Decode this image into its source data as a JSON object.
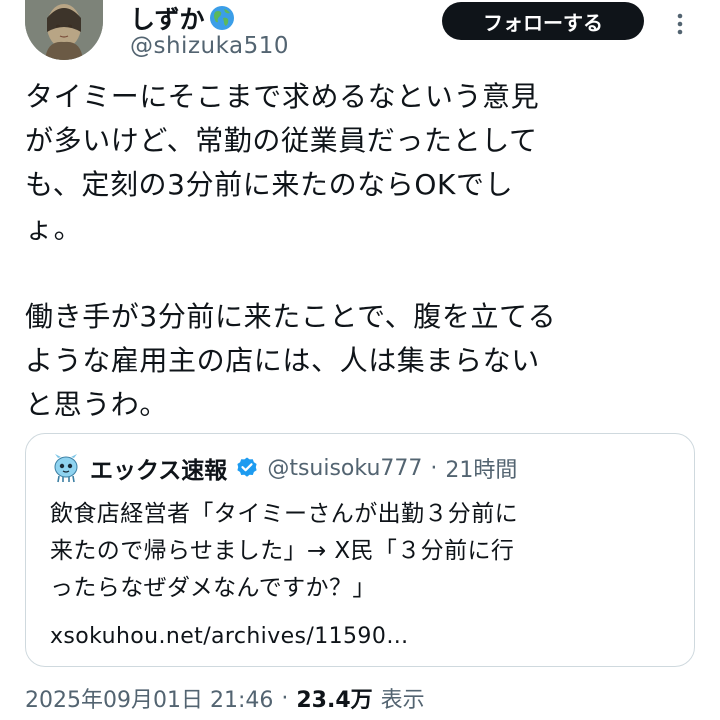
{
  "author": {
    "display_name": "しずか",
    "handle": "@shizuka510",
    "globe_icon": "globe-americas-icon",
    "avatar_icon": "profile-photo"
  },
  "header": {
    "follow_label": "フォローする",
    "more_icon": "more-vertical-icon"
  },
  "tweet": {
    "paragraph_1": "タイミーにそこまで求めるなという意見\nが多いけど、常勤の従業員だったとして\nも、定刻の3分前に来たのならOKでし\nょ。",
    "paragraph_2": "働き手が3分前に来たことで、腹を立てる\nような雇用主の店には、人は集まらない\nと思うわ。"
  },
  "quote": {
    "name": "エックス速報",
    "handle": "@tsuisoku777",
    "separator": "·",
    "time": "21時間",
    "verified_color": "#1d9bf0",
    "text": "飲食店経営者「タイミーさんが出勤３分前に\n来たので帰らせました」→ X民「３分前に行\nったらなぜダメなんですか？」",
    "link": "xsokuhou.net/archives/11590…"
  },
  "meta": {
    "timestamp": "2025年09月01日 21:46",
    "separator": "·",
    "views_count": "23.4万",
    "views_label": "表示"
  },
  "colors": {
    "text_primary": "#0f1419",
    "text_secondary": "#536471",
    "border": "#cfd9de",
    "follow_bg": "#0f1419"
  }
}
